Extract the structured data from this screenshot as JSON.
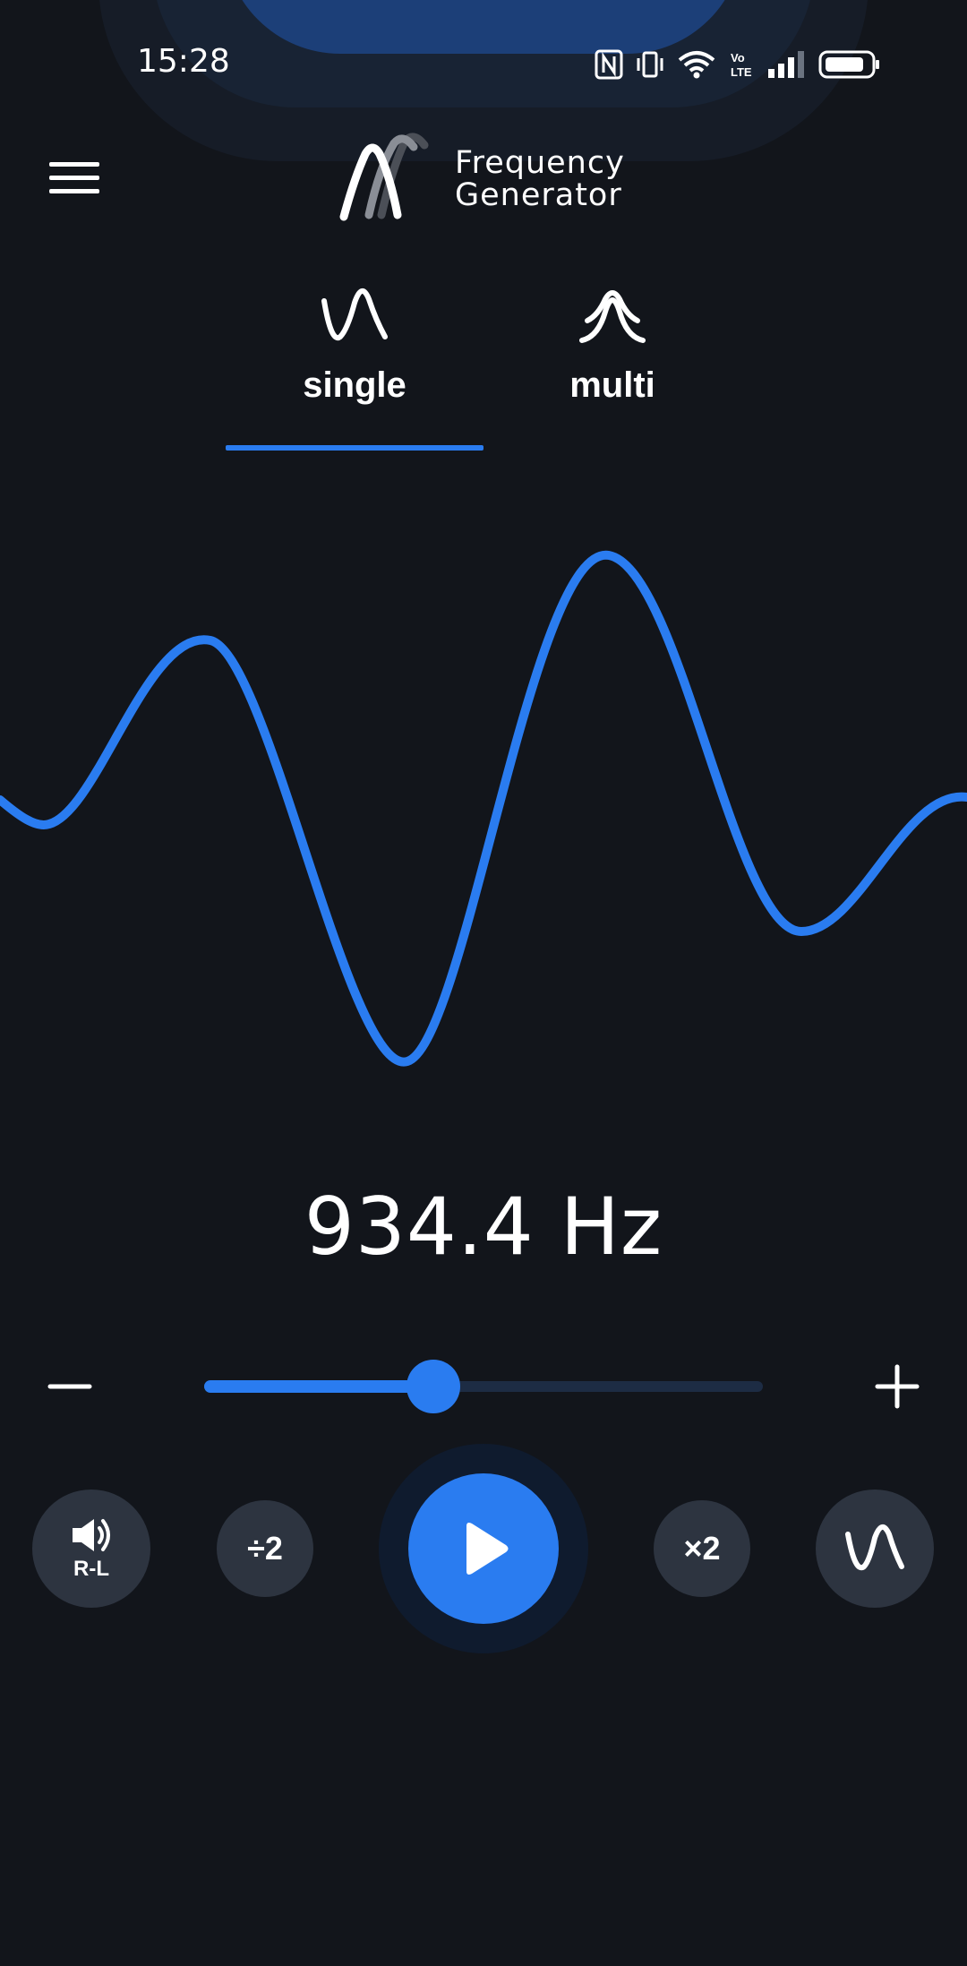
{
  "status_bar": {
    "time": "15:28",
    "icons": [
      "nfc-icon",
      "vibrate-icon",
      "wifi-icon",
      "volte-icon",
      "signal-icon",
      "battery-icon"
    ]
  },
  "header": {
    "title_line1": "Frequency",
    "title_line2": "Generator",
    "menu_icon": "hamburger-menu-icon",
    "logo_icon": "frequency-wave-logo"
  },
  "tabs": [
    {
      "label": "single",
      "icon": "single-wave-icon",
      "selected": true
    },
    {
      "label": "multi",
      "icon": "multi-wave-icon",
      "selected": false
    }
  ],
  "frequency": {
    "display": "934.4 Hz"
  },
  "slider": {
    "value_fraction": 0.41,
    "minus_icon": "minus-icon",
    "plus_icon": "plus-icon"
  },
  "controls": {
    "stereo_label": "R-L",
    "divide_label": "÷2",
    "multiply_label": "×2",
    "play_icon": "play-icon",
    "waveform_icon": "sine-wave-icon",
    "speaker_icon": "speaker-icon"
  },
  "colors": {
    "background": "#12151b",
    "accent": "#2a7cf0",
    "button_bg": "#2d3440",
    "text": "#ffffff"
  }
}
